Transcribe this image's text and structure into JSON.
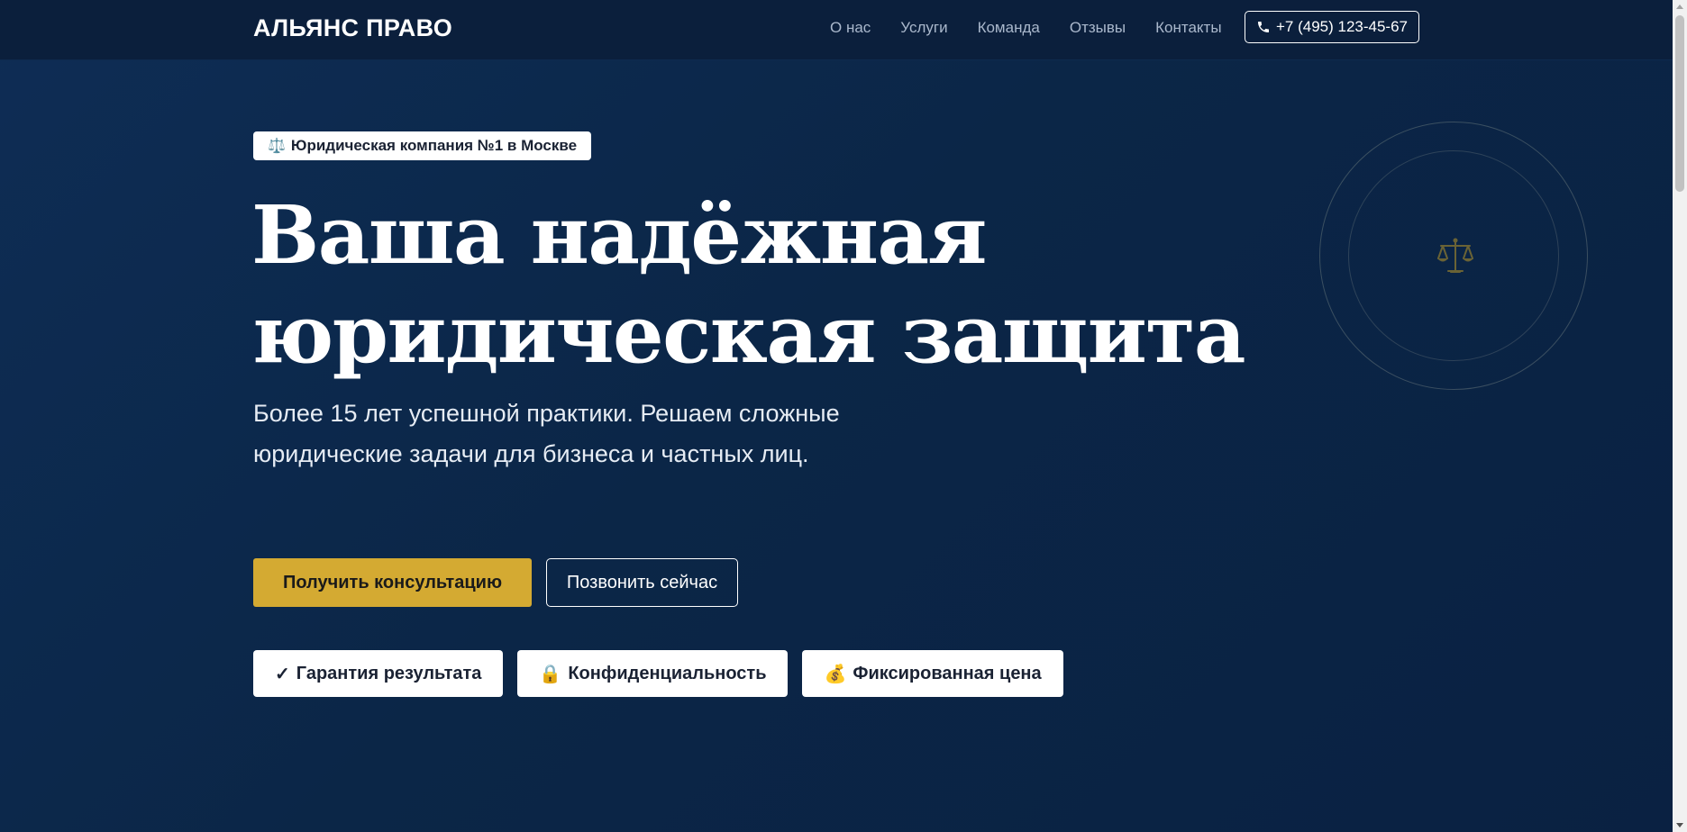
{
  "header": {
    "logo": "АЛЬЯНС ПРАВО",
    "nav": [
      {
        "label": "О нас"
      },
      {
        "label": "Услуги"
      },
      {
        "label": "Команда"
      },
      {
        "label": "Отзывы"
      },
      {
        "label": "Контакты"
      }
    ],
    "phone": "+7 (495) 123-45-67",
    "phone_icon": "phone-icon"
  },
  "hero": {
    "badge": "Юридическая компания №1 в Москве",
    "badge_icon": "⚖️",
    "title_line1": "Ваша надёжная",
    "title_line2": "юридическая защита",
    "subtitle": "Более 15 лет успешной практики. Решаем сложные юридические задачи для бизнеса и частных лиц.",
    "primary_button": "Получить консультацию",
    "secondary_button": "Позвонить сейчас",
    "features": [
      {
        "icon": "✓",
        "label": "Гарантия результата"
      },
      {
        "icon": "🔒",
        "label": "Конфиденциальность"
      },
      {
        "icon": "💰",
        "label": "Фиксированная цена"
      }
    ],
    "emblem_icon": "scales-icon"
  },
  "colors": {
    "background": "#0b2647",
    "header": "#0b1f3c",
    "accent": "#d4aa32",
    "text": "#ffffff"
  }
}
